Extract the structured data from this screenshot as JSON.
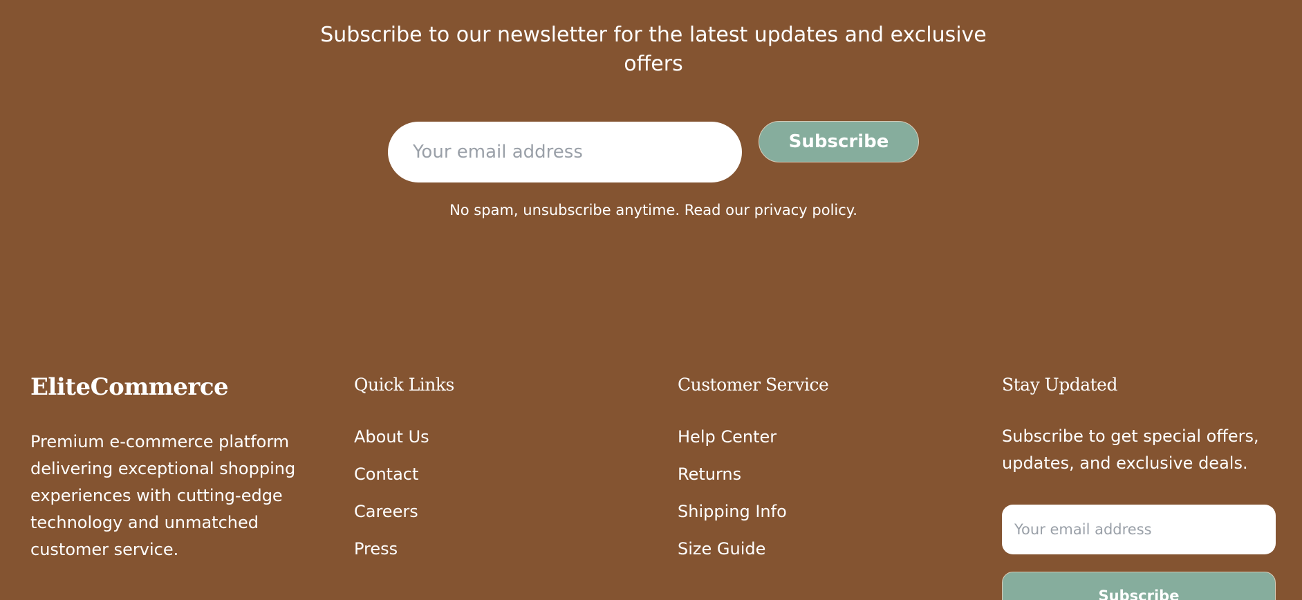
{
  "newsletter": {
    "title": "Subscribe to our newsletter for the latest updates and exclusive offers",
    "email_placeholder": "Your email address",
    "subscribe_label": "Subscribe",
    "note": "No spam, unsubscribe anytime. Read our privacy policy."
  },
  "footer": {
    "brand": {
      "name": "EliteCommerce",
      "description": "Premium e-commerce platform delivering exceptional shopping experiences with cutting-edge technology and unmatched customer service."
    },
    "quick_links": {
      "heading": "Quick Links",
      "items": [
        "About Us",
        "Contact",
        "Careers",
        "Press"
      ]
    },
    "customer_service": {
      "heading": "Customer Service",
      "items": [
        "Help Center",
        "Returns",
        "Shipping Info",
        "Size Guide"
      ]
    },
    "stay_updated": {
      "heading": "Stay Updated",
      "description": "Subscribe to get special offers, updates, and exclusive deals.",
      "email_placeholder": "Your email address",
      "subscribe_label": "Subscribe"
    }
  },
  "colors": {
    "background": "#845431",
    "accent": "#86ad9d",
    "text": "#ffffff"
  }
}
